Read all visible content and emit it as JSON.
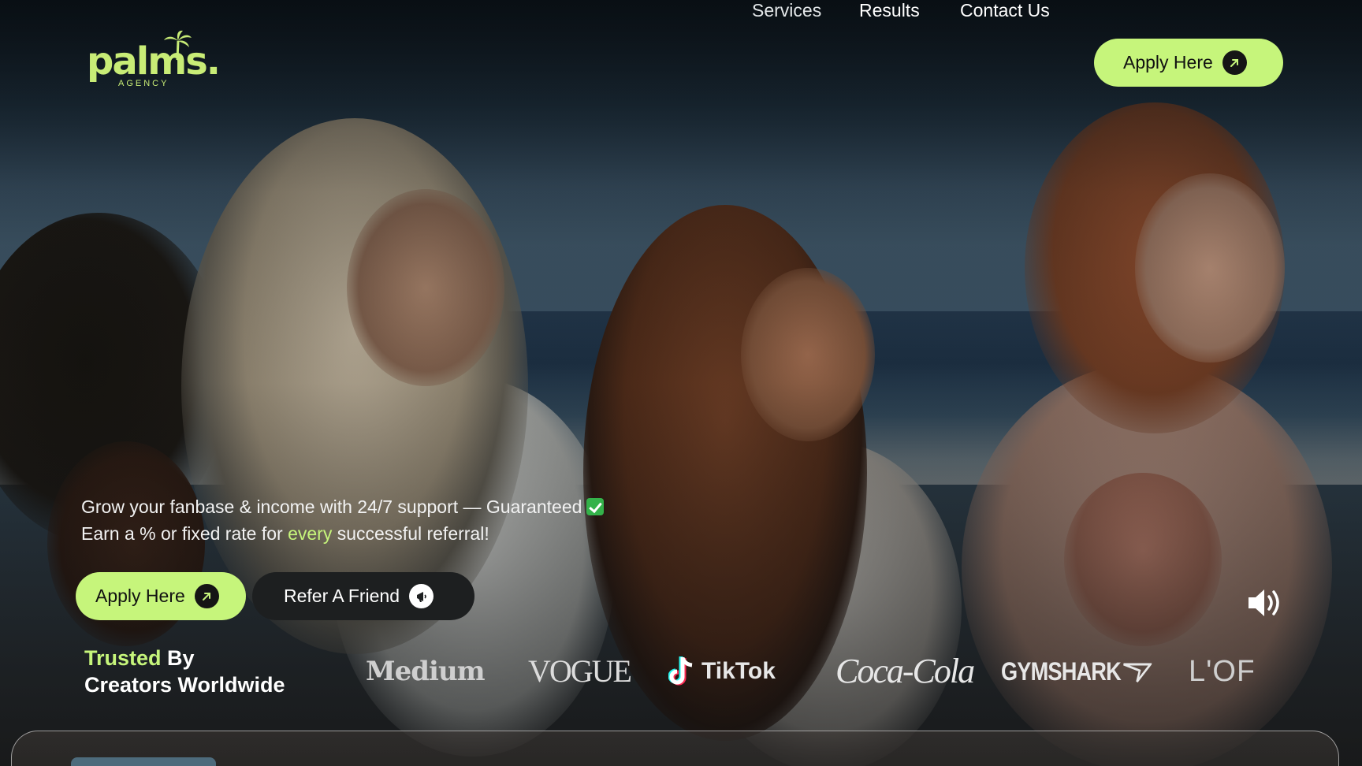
{
  "brand": {
    "logo_text": "palms.",
    "logo_subtext": "AGENCY",
    "accent_color": "#c6f57b"
  },
  "nav": {
    "links": [
      {
        "label": "Services"
      },
      {
        "label": "Results"
      },
      {
        "label": "Contact Us"
      }
    ],
    "apply_label": "Apply Here",
    "apply_icon": "arrow-up-right-icon"
  },
  "hero": {
    "line1": "Grow your fanbase & income with 24/7 support — Guaranteed",
    "line1_icon": "check-mark-icon",
    "line2_pre": "Earn a % or fixed rate for ",
    "line2_accent": "every",
    "line2_post": " successful referral!",
    "apply_label": "Apply Here",
    "refer_label": "Refer A Friend",
    "refer_icon": "megaphone-icon",
    "sound_icon": "speaker-volume-icon"
  },
  "trusted": {
    "accent": "Trusted",
    "rest": " By",
    "line2": "Creators Worldwide",
    "brands": [
      "Medium",
      "VOGUE",
      "TikTok",
      "Coca-Cola",
      "GYMSHARK",
      "L'OF"
    ]
  }
}
